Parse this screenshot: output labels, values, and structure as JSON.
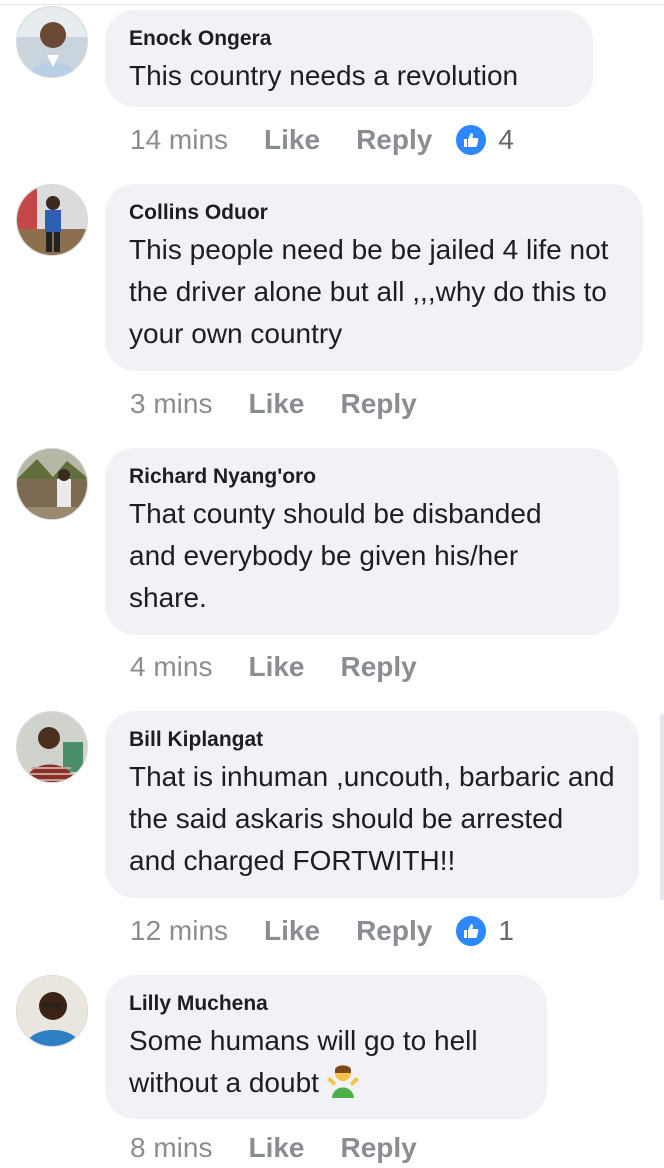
{
  "comments": [
    {
      "author": "Enock Ongera",
      "text": "This country needs a revolution",
      "time": "14 mins",
      "like_label": "Like",
      "reply_label": "Reply",
      "reactions": "4",
      "avatar_icon": "profile-photo"
    },
    {
      "author": "Collins Oduor",
      "text": "This people need be be jailed 4 life not the driver alone but all ,,,why do this to your own country",
      "time": "3 mins",
      "like_label": "Like",
      "reply_label": "Reply",
      "avatar_icon": "profile-photo"
    },
    {
      "author": "Richard Nyang'oro",
      "text": "That county should be disbanded and everybody be given his/her share.",
      "time": "4 mins",
      "like_label": "Like",
      "reply_label": "Reply",
      "avatar_icon": "profile-photo"
    },
    {
      "author": "Bill Kiplangat",
      "text": "That is inhuman ,uncouth, barbaric and the said askaris should be arrested and charged FORTWITH!!",
      "time": "12 mins",
      "like_label": "Like",
      "reply_label": "Reply",
      "reactions": "1",
      "avatar_icon": "profile-photo"
    },
    {
      "author": "Lilly Muchena",
      "text": "Some humans will go to hell without a doubt",
      "emoji": "person-shrugging-emoji",
      "time": "8 mins",
      "like_label": "Like",
      "reply_label": "Reply",
      "avatar_icon": "profile-photo"
    }
  ],
  "colors": {
    "bubble": "#f0f2f5",
    "meta_text": "#8a8d91",
    "like_badge": "#2d88ff"
  }
}
